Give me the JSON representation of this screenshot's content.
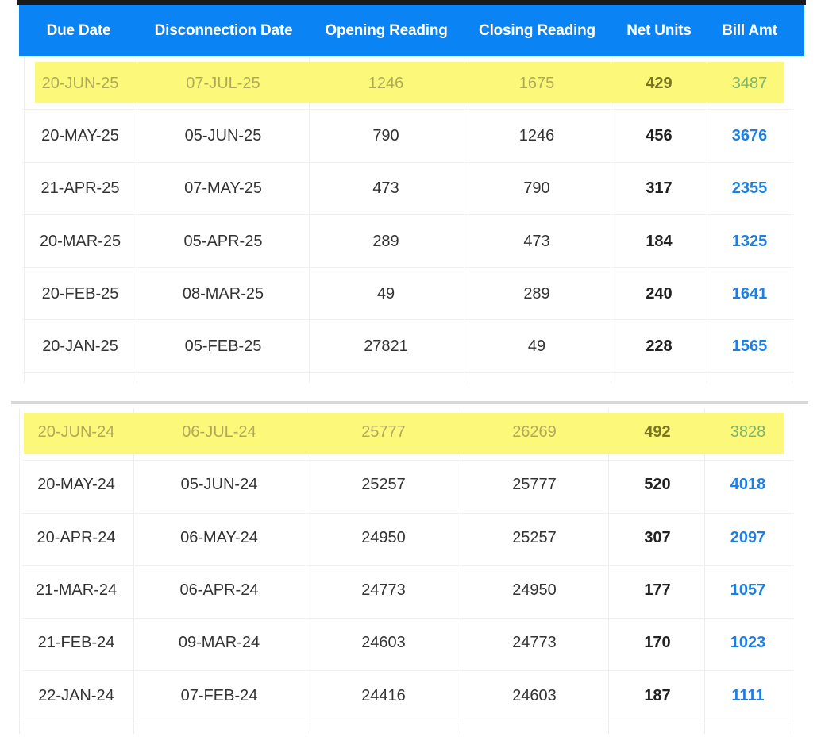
{
  "headers": [
    "Due Date",
    "Disconnection Date",
    "Opening Reading",
    "Closing Reading",
    "Net Units",
    "Bill Amt"
  ],
  "tables": [
    {
      "rows": [
        {
          "due": "20-JUN-25",
          "disc": "07-JUL-25",
          "open": "1246",
          "close": "1675",
          "units": "429",
          "amt": "3487",
          "highlight": true
        },
        {
          "due": "20-MAY-25",
          "disc": "05-JUN-25",
          "open": "790",
          "close": "1246",
          "units": "456",
          "amt": "3676",
          "highlight": false
        },
        {
          "due": "21-APR-25",
          "disc": "07-MAY-25",
          "open": "473",
          "close": "790",
          "units": "317",
          "amt": "2355",
          "highlight": false
        },
        {
          "due": "20-MAR-25",
          "disc": "05-APR-25",
          "open": "289",
          "close": "473",
          "units": "184",
          "amt": "1325",
          "highlight": false
        },
        {
          "due": "20-FEB-25",
          "disc": "08-MAR-25",
          "open": "49",
          "close": "289",
          "units": "240",
          "amt": "1641",
          "highlight": false
        },
        {
          "due": "20-JAN-25",
          "disc": "05-FEB-25",
          "open": "27821",
          "close": "49",
          "units": "228",
          "amt": "1565",
          "highlight": false
        }
      ]
    },
    {
      "rows": [
        {
          "due": "20-JUN-24",
          "disc": "06-JUL-24",
          "open": "25777",
          "close": "26269",
          "units": "492",
          "amt": "3828",
          "highlight": true
        },
        {
          "due": "20-MAY-24",
          "disc": "05-JUN-24",
          "open": "25257",
          "close": "25777",
          "units": "520",
          "amt": "4018",
          "highlight": false
        },
        {
          "due": "20-APR-24",
          "disc": "06-MAY-24",
          "open": "24950",
          "close": "25257",
          "units": "307",
          "amt": "2097",
          "highlight": false
        },
        {
          "due": "21-MAR-24",
          "disc": "06-APR-24",
          "open": "24773",
          "close": "24950",
          "units": "177",
          "amt": "1057",
          "highlight": false
        },
        {
          "due": "21-FEB-24",
          "disc": "09-MAR-24",
          "open": "24603",
          "close": "24773",
          "units": "170",
          "amt": "1023",
          "highlight": false
        },
        {
          "due": "22-JAN-24",
          "disc": "07-FEB-24",
          "open": "24416",
          "close": "24603",
          "units": "187",
          "amt": "1111",
          "highlight": false
        }
      ]
    }
  ],
  "colors": {
    "header_bg": "#0a84f5",
    "highlight": "#fbf87a",
    "amount_text": "#1f7fe0"
  }
}
